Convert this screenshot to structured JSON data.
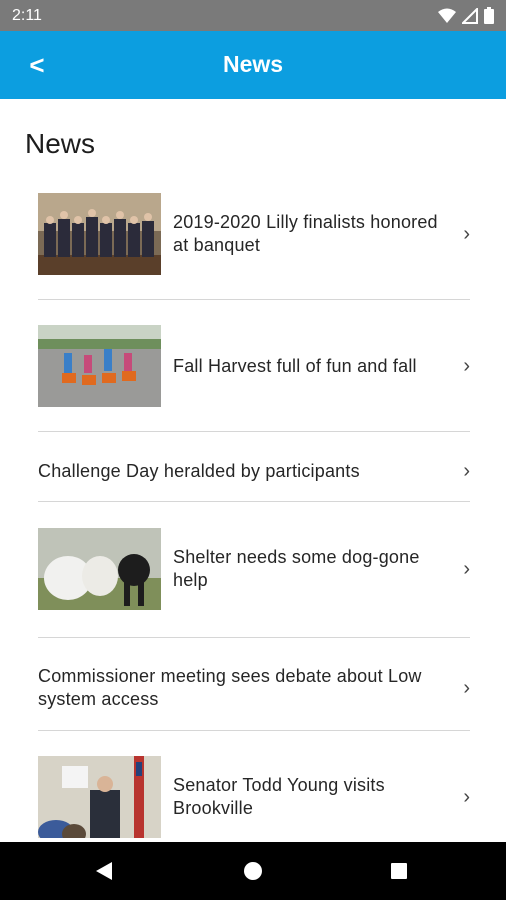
{
  "status_bar": {
    "time": "2:11"
  },
  "app_bar": {
    "back_label": "<",
    "title": "News"
  },
  "page": {
    "heading": "News"
  },
  "news": [
    {
      "title": "2019-2020 Lilly finalists honored at banquet",
      "has_image": true,
      "image": "group-photo-banquet"
    },
    {
      "title": "Fall Harvest full of fun and fall",
      "has_image": true,
      "image": "children-pumpkin-cars"
    },
    {
      "title": "Challenge Day heralded by participants",
      "has_image": false
    },
    {
      "title": "Shelter needs some dog-gone help",
      "has_image": true,
      "image": "white-and-black-dogs"
    },
    {
      "title": "Commissioner meeting sees debate about Low system access",
      "has_image": false
    },
    {
      "title": "Senator Todd Young visits Brookville",
      "has_image": true,
      "image": "senator-speaking-flag"
    }
  ],
  "colors": {
    "app_bar": "#0c9ee0",
    "status_bar": "#7a7a7a",
    "nav_bar": "#000000"
  }
}
